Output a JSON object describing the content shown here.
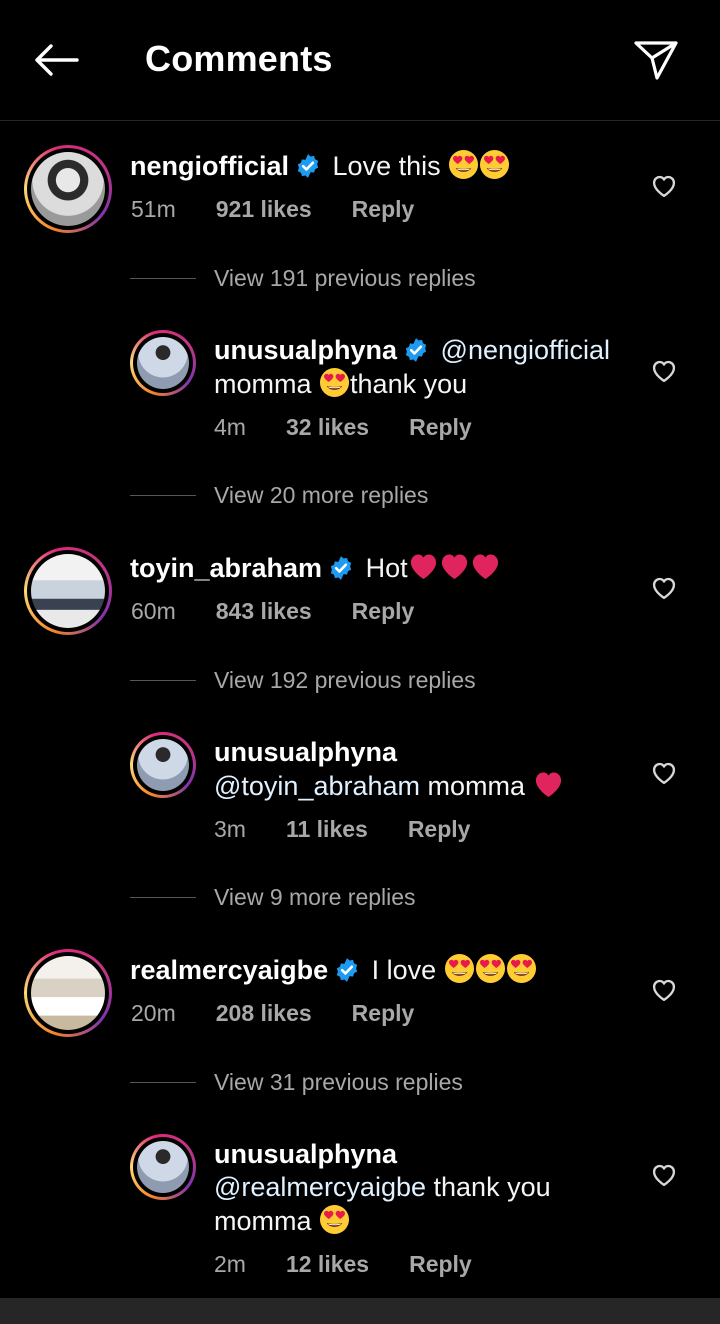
{
  "header": {
    "title": "Comments"
  },
  "comments": [
    {
      "username": "nengiofficial",
      "verified": true,
      "text": "Love this",
      "emojis": 2,
      "time": "51m",
      "likes": "921 likes",
      "reply": "Reply",
      "view_replies": "View 191 previous replies",
      "reply_item": {
        "username": "unusualphyna",
        "mention": "@nengiofficial",
        "text_line2_a": "momma",
        "text_line2_b": "thank you",
        "time": "4m",
        "likes": "32 likes",
        "reply": "Reply"
      },
      "more_replies": "View 20 more replies"
    },
    {
      "username": "toyin_abraham",
      "verified": true,
      "text": "Hot",
      "time": "60m",
      "likes": "843 likes",
      "reply": "Reply",
      "view_replies": "View 192 previous replies",
      "reply_item": {
        "username": "unusualphyna",
        "mention": "@toyin_abraham",
        "text": "momma",
        "time": "3m",
        "likes": "11 likes",
        "reply": "Reply"
      },
      "more_replies": "View 9 more replies"
    },
    {
      "username": "realmercyaigbe",
      "verified": true,
      "text": "I love",
      "time": "20m",
      "likes": "208 likes",
      "reply": "Reply",
      "view_replies": "View 31 previous replies",
      "reply_item": {
        "username": "unusualphyna",
        "mention": "@realmercyaigbe",
        "text": "thank you",
        "text_line3": "momma",
        "time": "2m",
        "likes": "12 likes",
        "reply": "Reply"
      }
    }
  ],
  "colors": {
    "verified": "#1d9bf0",
    "heart_emoji": "#e0245e",
    "secondary_text": "#a8a8a8"
  }
}
